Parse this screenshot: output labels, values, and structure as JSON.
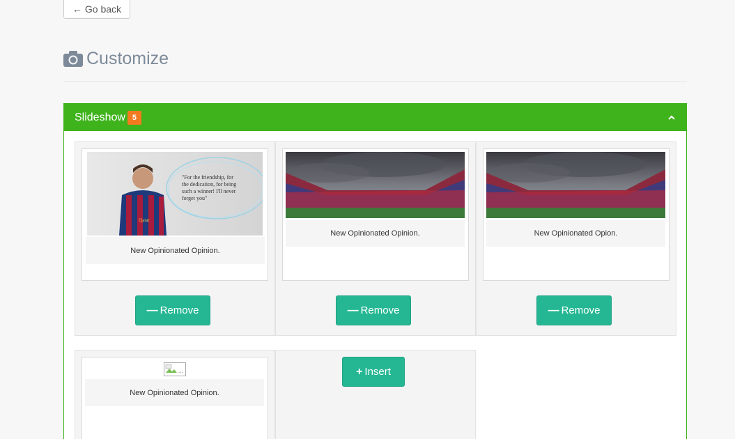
{
  "nav": {
    "go_back_arrow": "←",
    "go_back_label": "Go back"
  },
  "page": {
    "title": "Customize",
    "icon": "camera-icon"
  },
  "panel": {
    "title": "Slideshow",
    "badge": "5",
    "toggle_icon": "chevron-up-icon",
    "colors": {
      "header": "#3fb31c",
      "badge": "#f47a20",
      "button": "#25b793"
    }
  },
  "slides": [
    {
      "caption": "New Opinionated Opinion.",
      "image": "player-quote",
      "quote": "\"For the friendship, for the dedication, for being such a winner! I'll never forget you\"",
      "action_label": "Remove"
    },
    {
      "caption": "New Opinionated Opinion.",
      "image": "stadium",
      "action_label": "Remove"
    },
    {
      "caption": "New Opinionated Opion.",
      "image": "stadium",
      "action_label": "Remove"
    },
    {
      "caption": "New Opinionated Opinion.",
      "image": "broken-image",
      "broken_alt": "...",
      "action_label": ""
    }
  ],
  "insert": {
    "label": "Insert"
  }
}
